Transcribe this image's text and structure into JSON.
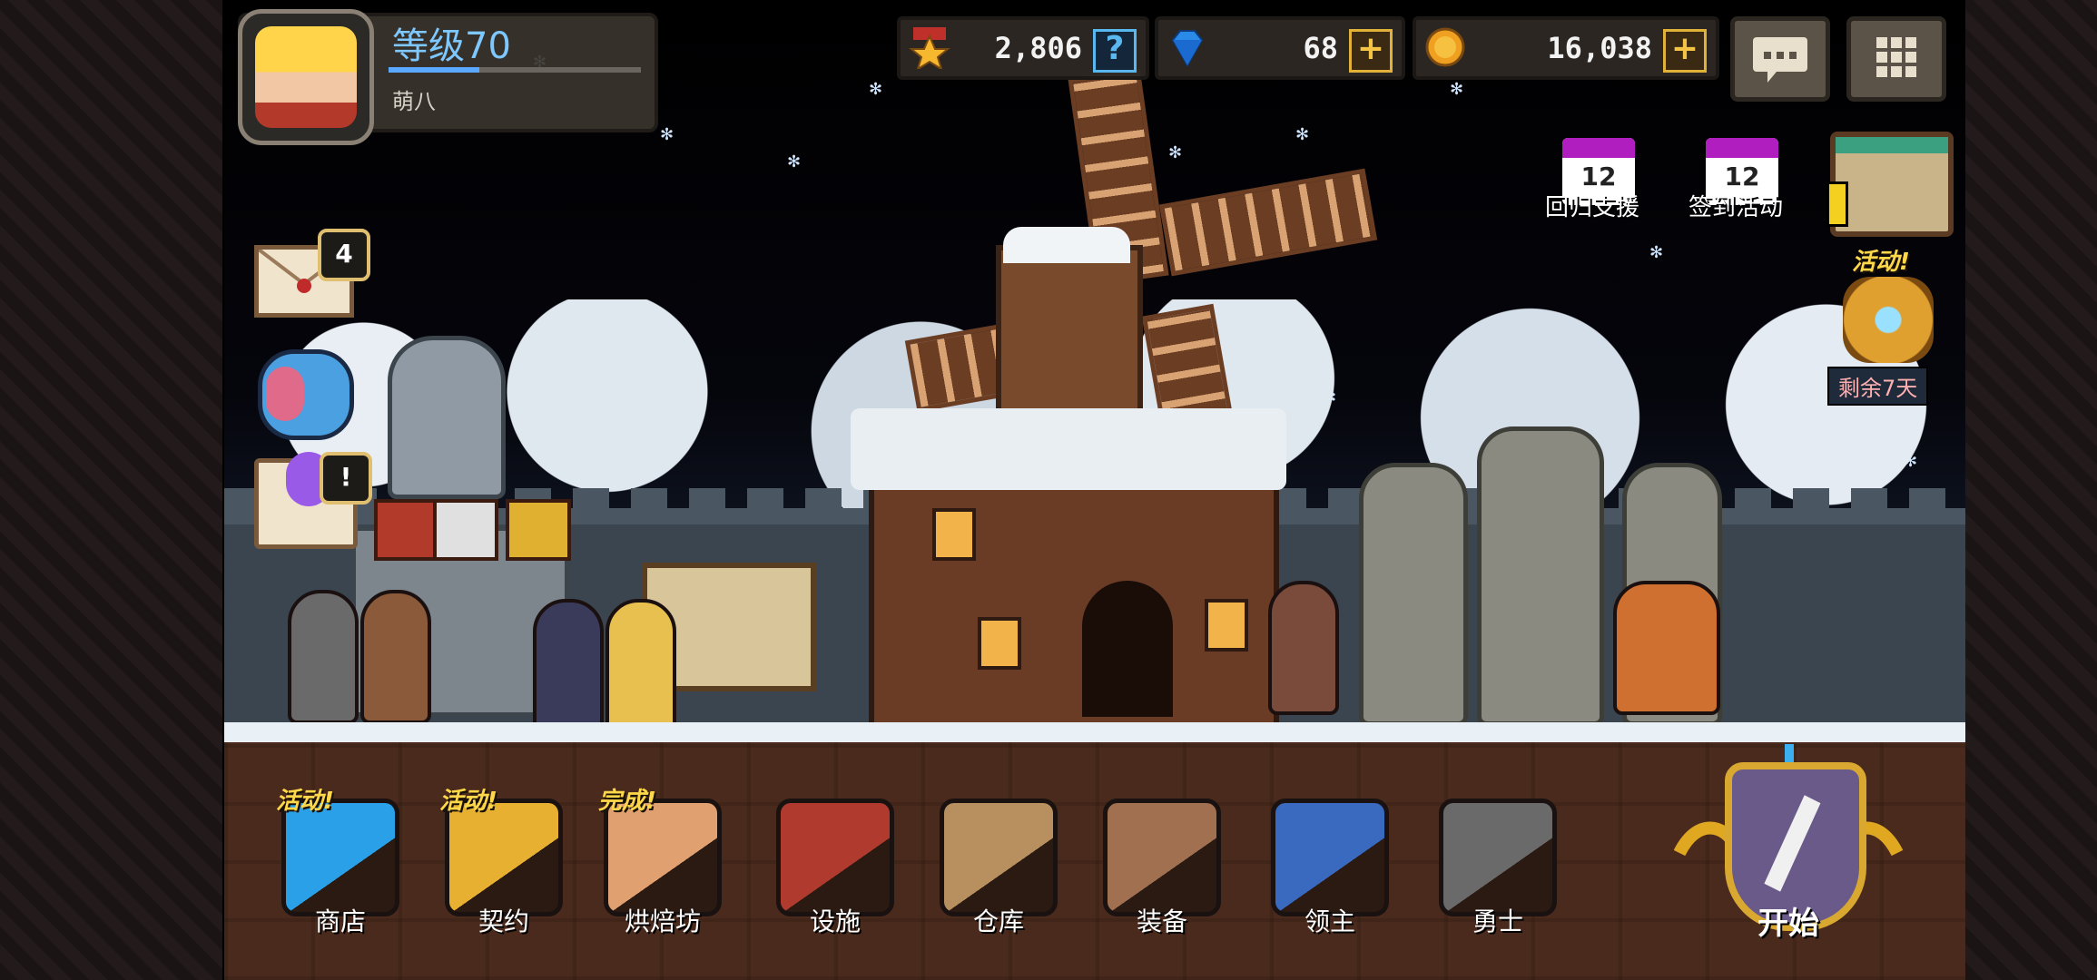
{
  "player": {
    "level": "等级70",
    "name": "萌八",
    "xp_fraction": 0.36
  },
  "resources": {
    "rank_points": "2,806",
    "gems": "68",
    "gold": "16,038",
    "rank_button": "?",
    "add_button": "+"
  },
  "mail": {
    "count": "4"
  },
  "quest_badge": "!",
  "events": {
    "return_support": "回归支援",
    "sign_in": "签到活动",
    "calendar_day": "12",
    "active_tag": "活动!",
    "days_left": "剩余7天"
  },
  "bottom_menu": [
    {
      "id": "shop",
      "label": "商店",
      "tag": "活动!",
      "icon": "gem-gold-icon",
      "color": "#2aa0e8"
    },
    {
      "id": "contract",
      "label": "契约",
      "tag": "活动!",
      "icon": "scroll-icon",
      "color": "#e8b030"
    },
    {
      "id": "bakery",
      "label": "烘焙坊",
      "tag": "完成!",
      "icon": "bread-icon",
      "color": "#e0a070"
    },
    {
      "id": "facilities",
      "label": "设施",
      "tag": "",
      "icon": "building-icon",
      "color": "#b03a2e"
    },
    {
      "id": "warehouse",
      "label": "仓库",
      "tag": "",
      "icon": "barn-icon",
      "color": "#b89060"
    },
    {
      "id": "equipment",
      "label": "装备",
      "tag": "",
      "icon": "equipment-bag-icon",
      "color": "#a07050"
    },
    {
      "id": "lord",
      "label": "领主",
      "tag": "",
      "icon": "knight-armor-icon",
      "color": "#3a6ac0"
    },
    {
      "id": "warrior",
      "label": "勇士",
      "tag": "",
      "icon": "helmet-icon",
      "color": "#6a6a6a"
    }
  ],
  "start_label": "开始",
  "colors": {
    "level_text": "#7ec8ff",
    "plus_button": "#f4c447",
    "tag_yellow": "#ffd84a"
  }
}
